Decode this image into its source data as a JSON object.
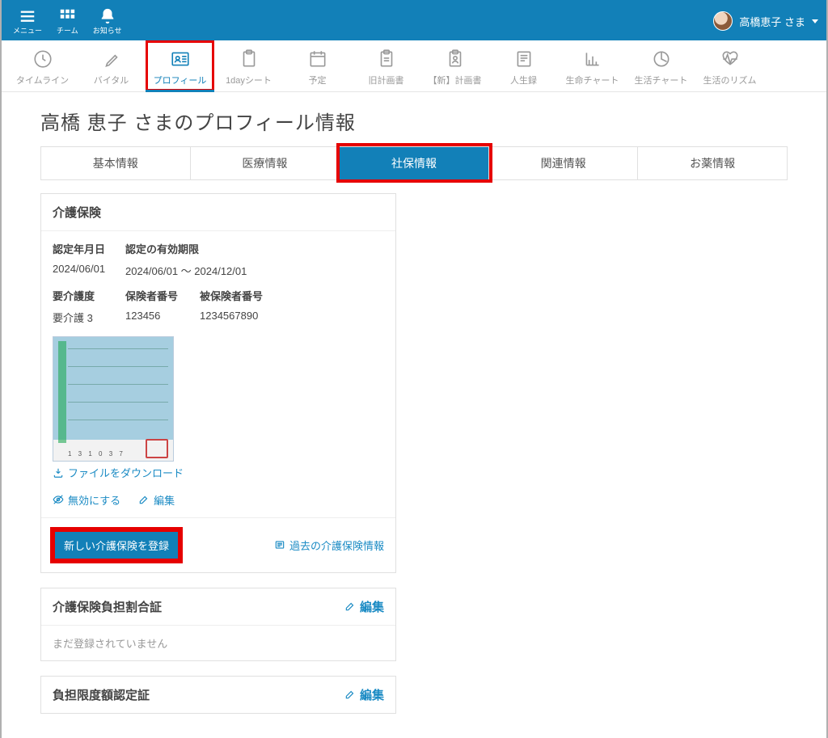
{
  "topbar": {
    "menu": "メニュー",
    "team": "チーム",
    "notice": "お知らせ",
    "user_name": "高橋恵子",
    "user_suffix": " さま"
  },
  "nav": {
    "timeline": "タイムライン",
    "vital": "バイタル",
    "profile": "プロフィール",
    "oneday": "1dayシート",
    "schedule": "予定",
    "plan_old": "旧計画書",
    "plan_new": "【新】計画書",
    "life_record": "人生録",
    "life_chart": "生命チャート",
    "activity_chart": "生活チャート",
    "rhythm": "生活のリズム"
  },
  "page_title": "高橋 恵子 さまのプロフィール情報",
  "tabs": {
    "basic": "基本情報",
    "medical": "医療情報",
    "shaho": "社保情報",
    "related": "関連情報",
    "medicine": "お薬情報"
  },
  "insurance_card": {
    "title": "介護保険",
    "cert_date_label": "認定年月日",
    "cert_date_value": "2024/06/01",
    "valid_label": "認定の有効期限",
    "valid_value": "2024/06/01 ～ 2024/12/01",
    "level_label": "要介護度",
    "level_value": "要介護 3",
    "insurer_label": "保険者番号",
    "insurer_value": "123456",
    "insured_label": "被保険者番号",
    "insured_value": "1234567890",
    "download_label": "ファイルをダウンロード",
    "disable_label": "無効にする",
    "edit_label": "編集",
    "new_button": "新しい介護保険を登録",
    "past_link": "過去の介護保険情報",
    "doc_numbers": "1 3 1 0 3 7"
  },
  "burden_card": {
    "title": "介護保険負担割合証",
    "edit_label": "編集",
    "empty": "まだ登録されていません"
  },
  "limit_card": {
    "title": "負担限度額認定証",
    "edit_label": "編集"
  }
}
